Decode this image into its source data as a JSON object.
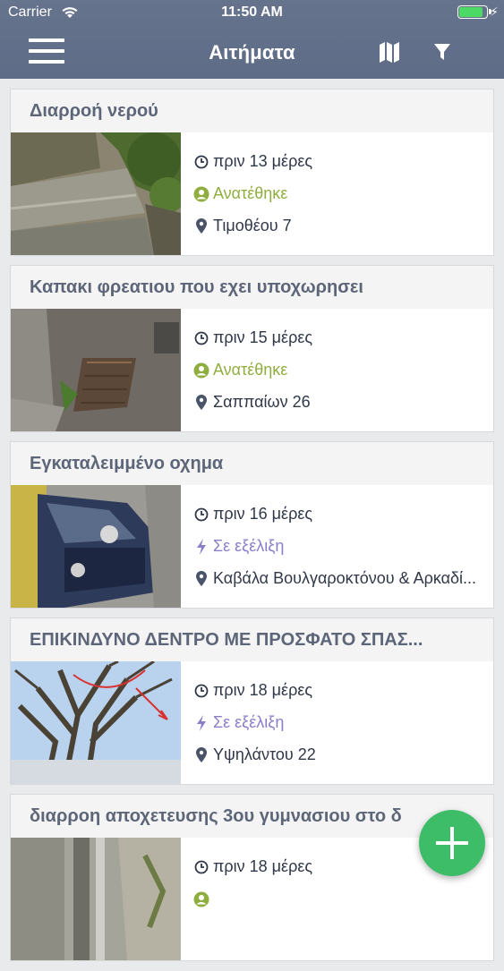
{
  "status_bar": {
    "carrier": "Carrier",
    "time": "11:50 AM"
  },
  "nav": {
    "title": "Αιτήματα",
    "menu_icon": "hamburger-icon",
    "map_icon": "map-icon",
    "filter_icon": "filter-icon"
  },
  "colors": {
    "header": "#66738d",
    "assigned": "#8fae3f",
    "in_progress": "#8a7ec9",
    "fab": "#3dbd67"
  },
  "requests": [
    {
      "title": "Διαρροή νερού",
      "time": "πριν 13 μέρες",
      "status": "Ανατέθηκε",
      "status_type": "assigned",
      "address": "Τιμοθέου 7"
    },
    {
      "title": "Καπακι φρεατιου που εχει υποχωρησει",
      "time": "πριν 15 μέρες",
      "status": "Ανατέθηκε",
      "status_type": "assigned",
      "address": "Σαππαίων 26"
    },
    {
      "title": "Εγκαταλειμμένο οχημα",
      "time": "πριν 16 μέρες",
      "status": "Σε εξέλιξη",
      "status_type": "in-progress",
      "address": "Καβάλα Βουλγαροκτόνου & Αρκαδί..."
    },
    {
      "title": "ΕΠΙΚΙΝΔΥΝΟ ΔΕΝΤΡΟ ΜΕ ΠΡΟΣΦΑΤΟ ΣΠΑΣ...",
      "time": "πριν 18 μέρες",
      "status": "Σε εξέλιξη",
      "status_type": "in-progress",
      "address": "Υψηλάντου 22"
    },
    {
      "title": "διαρροη αποχετευσης 3ου γυμνασιου στο δ",
      "time": "πριν 18 μέρες",
      "status": "",
      "status_type": "",
      "address": ""
    }
  ],
  "fab": {
    "icon": "plus-icon"
  }
}
